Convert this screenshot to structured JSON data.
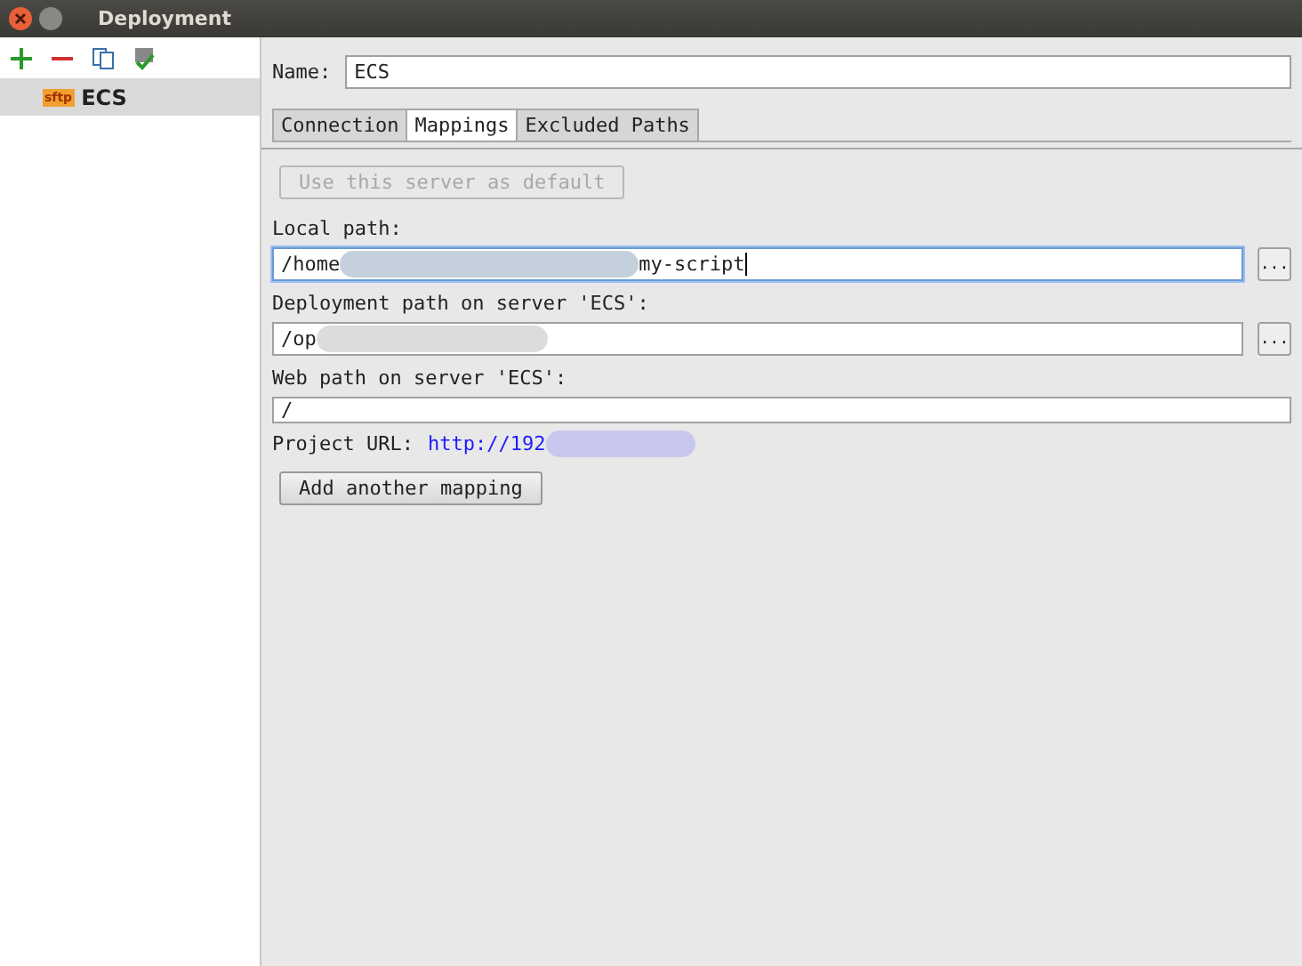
{
  "window": {
    "title": "Deployment"
  },
  "sidebar": {
    "items": [
      {
        "label": "ECS",
        "icon_text": "sftp",
        "selected": true
      }
    ]
  },
  "name_field": {
    "label": "Name:",
    "value": "ECS"
  },
  "tabs": [
    {
      "label": "Connection",
      "selected": false
    },
    {
      "label": "Mappings",
      "selected": true
    },
    {
      "label": "Excluded Paths",
      "selected": false
    }
  ],
  "default_button": {
    "label": "Use this server as default",
    "disabled": true
  },
  "local_path": {
    "label": "Local path:",
    "value_start": "/home",
    "value_end": "my-script",
    "browse": "..."
  },
  "deployment_path": {
    "label": "Deployment path on server 'ECS':",
    "value_start": "/op",
    "browse": "..."
  },
  "web_path": {
    "label": "Web path on server 'ECS':",
    "value": "/"
  },
  "project_url": {
    "label": "Project URL:",
    "link": "http://192"
  },
  "add_button": {
    "label": "Add another mapping"
  }
}
